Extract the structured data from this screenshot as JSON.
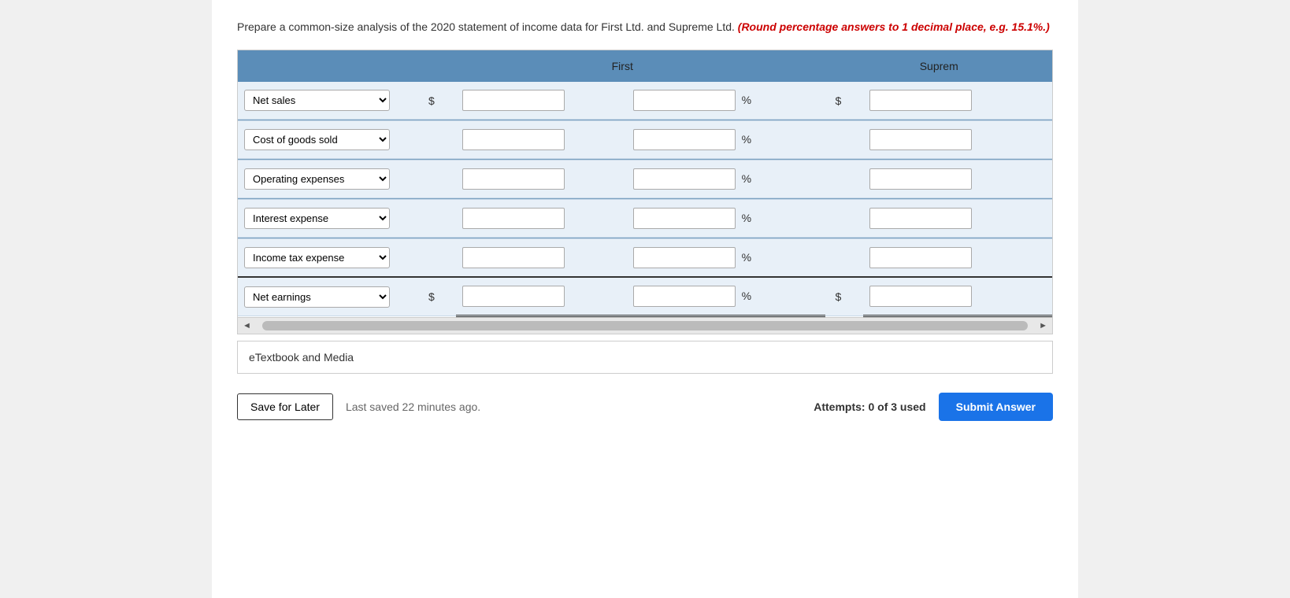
{
  "instructions": {
    "main": "Prepare a common-size analysis of the 2020 statement of income data for First Ltd. and Supreme Ltd.",
    "note": "(Round percentage answers to 1 decimal place, e.g. 15.1%.)"
  },
  "table": {
    "header": {
      "col_label": "",
      "first_label": "First",
      "supreme_label": "Suprem"
    },
    "rows": [
      {
        "id": "net-sales",
        "label": "Net sales",
        "has_dollar_first": true,
        "has_dollar_supreme": true,
        "show_pct": true
      },
      {
        "id": "cost-of-goods-sold",
        "label": "Cost of goods sold",
        "has_dollar_first": false,
        "has_dollar_supreme": false,
        "show_pct": true
      },
      {
        "id": "operating-expenses",
        "label": "Operating expenses",
        "has_dollar_first": false,
        "has_dollar_supreme": false,
        "show_pct": true
      },
      {
        "id": "interest-expense",
        "label": "Interest expense",
        "has_dollar_first": false,
        "has_dollar_supreme": false,
        "show_pct": true
      },
      {
        "id": "income-tax-expense",
        "label": "Income tax expense",
        "has_dollar_first": false,
        "has_dollar_supreme": false,
        "show_pct": true
      },
      {
        "id": "net-earnings",
        "label": "Net earnings",
        "has_dollar_first": true,
        "has_dollar_supreme": true,
        "show_pct": true,
        "is_total": true
      }
    ],
    "row_options": [
      "Net sales",
      "Cost of goods sold",
      "Operating expenses",
      "Interest expense",
      "Income tax expense",
      "Net earnings"
    ]
  },
  "scrollbar": {
    "left_arrow": "◄",
    "right_arrow": "►"
  },
  "etextbook": {
    "label": "eTextbook and Media"
  },
  "footer": {
    "save_later": "Save for Later",
    "last_saved": "Last saved 22 minutes ago.",
    "attempts": "Attempts: 0 of 3 used",
    "submit": "Submit Answer"
  }
}
